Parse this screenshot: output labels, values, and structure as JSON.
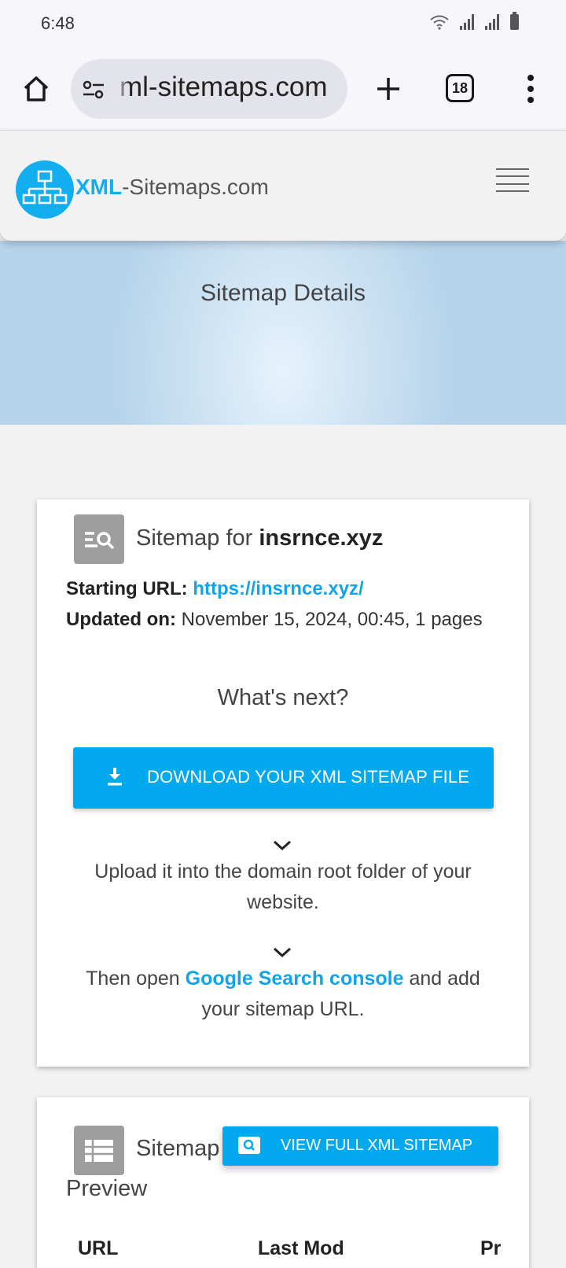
{
  "status_bar": {
    "time": "6:48"
  },
  "browser": {
    "url": "ml-sitemaps.com",
    "tab_count": "18"
  },
  "site": {
    "logo_brand": "XML",
    "logo_rest": "-Sitemaps.com"
  },
  "hero": {
    "title": "Sitemap Details"
  },
  "sitemap_card": {
    "title_prefix": "Sitemap for ",
    "domain": "insrnce.xyz",
    "starting_url_label": "Starting URL:",
    "starting_url": "https://insrnce.xyz/",
    "updated_label": "Updated on:",
    "updated_value": "November 15, 2024, 00:45, 1 pages",
    "whats_next": "What's next?",
    "download_label": "DOWNLOAD YOUR XML SITEMAP FILE",
    "step1_line1": "Upload it into the domain root folder of your",
    "step1_line2": "website.",
    "step2_prefix": "Then open ",
    "step2_link": "Google Search console",
    "step2_suffix": " and add",
    "step2_line2": "your sitemap URL."
  },
  "preview_card": {
    "title_word": "Sitemap",
    "title_word2": "Preview",
    "view_button": "VIEW FULL XML SITEMAP",
    "columns": [
      "URL",
      "Last Mod",
      "Pr"
    ]
  },
  "colors": {
    "accent": "#03a9ee",
    "link": "#12a4e6",
    "icon_bg": "#9e9e9e"
  },
  "icons": [
    "home-icon",
    "tune-icon",
    "plus-icon",
    "tabs-icon",
    "more-vert-icon",
    "sitemap-logo-icon",
    "hamburger-icon",
    "search-list-icon",
    "download-icon",
    "chevron-down-icon",
    "table-icon",
    "search-icon"
  ]
}
